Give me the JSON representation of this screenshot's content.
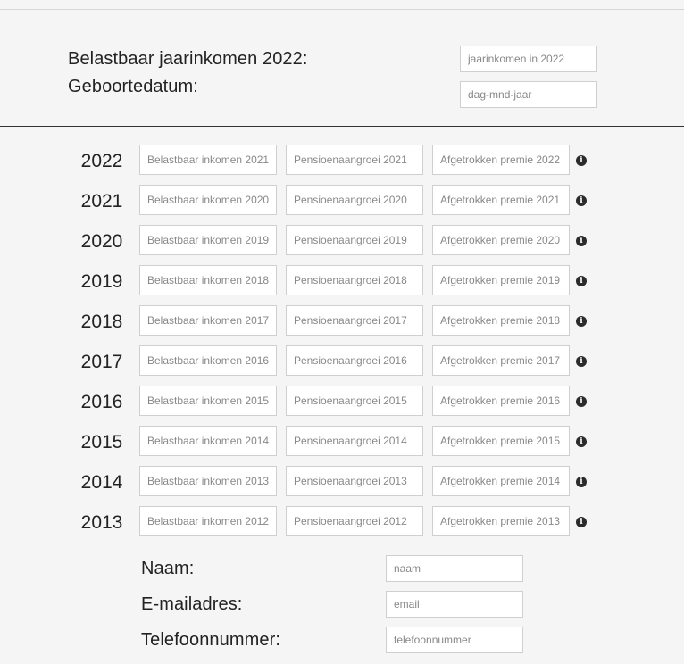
{
  "header": {
    "income_label": "Belastbaar jaarinkomen 2022:",
    "income_placeholder": "jaarinkomen in 2022",
    "birthdate_label": "Geboortedatum:",
    "birthdate_placeholder": "dag-mnd-jaar"
  },
  "rows": [
    {
      "year": "2022",
      "income_placeholder": "Belastbaar inkomen 2021",
      "pension_placeholder": "Pensioenaangroei 2021",
      "premium_placeholder": "Afgetrokken premie 2022"
    },
    {
      "year": "2021",
      "income_placeholder": "Belastbaar inkomen 2020",
      "pension_placeholder": "Pensioenaangroei 2020",
      "premium_placeholder": "Afgetrokken premie 2021"
    },
    {
      "year": "2020",
      "income_placeholder": "Belastbaar inkomen 2019",
      "pension_placeholder": "Pensioenaangroei 2019",
      "premium_placeholder": "Afgetrokken premie 2020"
    },
    {
      "year": "2019",
      "income_placeholder": "Belastbaar inkomen 2018",
      "pension_placeholder": "Pensioenaangroei 2018",
      "premium_placeholder": "Afgetrokken premie 2019"
    },
    {
      "year": "2018",
      "income_placeholder": "Belastbaar inkomen 2017",
      "pension_placeholder": "Pensioenaangroei 2017",
      "premium_placeholder": "Afgetrokken premie 2018"
    },
    {
      "year": "2017",
      "income_placeholder": "Belastbaar inkomen 2016",
      "pension_placeholder": "Pensioenaangroei 2016",
      "premium_placeholder": "Afgetrokken premie 2017"
    },
    {
      "year": "2016",
      "income_placeholder": "Belastbaar inkomen 2015",
      "pension_placeholder": "Pensioenaangroei 2015",
      "premium_placeholder": "Afgetrokken premie 2016"
    },
    {
      "year": "2015",
      "income_placeholder": "Belastbaar inkomen 2014",
      "pension_placeholder": "Pensioenaangroei 2014",
      "premium_placeholder": "Afgetrokken premie 2015"
    },
    {
      "year": "2014",
      "income_placeholder": "Belastbaar inkomen 2013",
      "pension_placeholder": "Pensioenaangroei 2013",
      "premium_placeholder": "Afgetrokken premie 2014"
    },
    {
      "year": "2013",
      "income_placeholder": "Belastbaar inkomen 2012",
      "pension_placeholder": "Pensioenaangroei 2012",
      "premium_placeholder": "Afgetrokken premie 2013"
    }
  ],
  "info_icon": "info-icon",
  "contact": {
    "name_label": "Naam:",
    "name_placeholder": "naam",
    "email_label": "E-mailadres:",
    "email_placeholder": "email",
    "phone_label": "Telefoonnummer:",
    "phone_placeholder": "telefoonnummer"
  }
}
